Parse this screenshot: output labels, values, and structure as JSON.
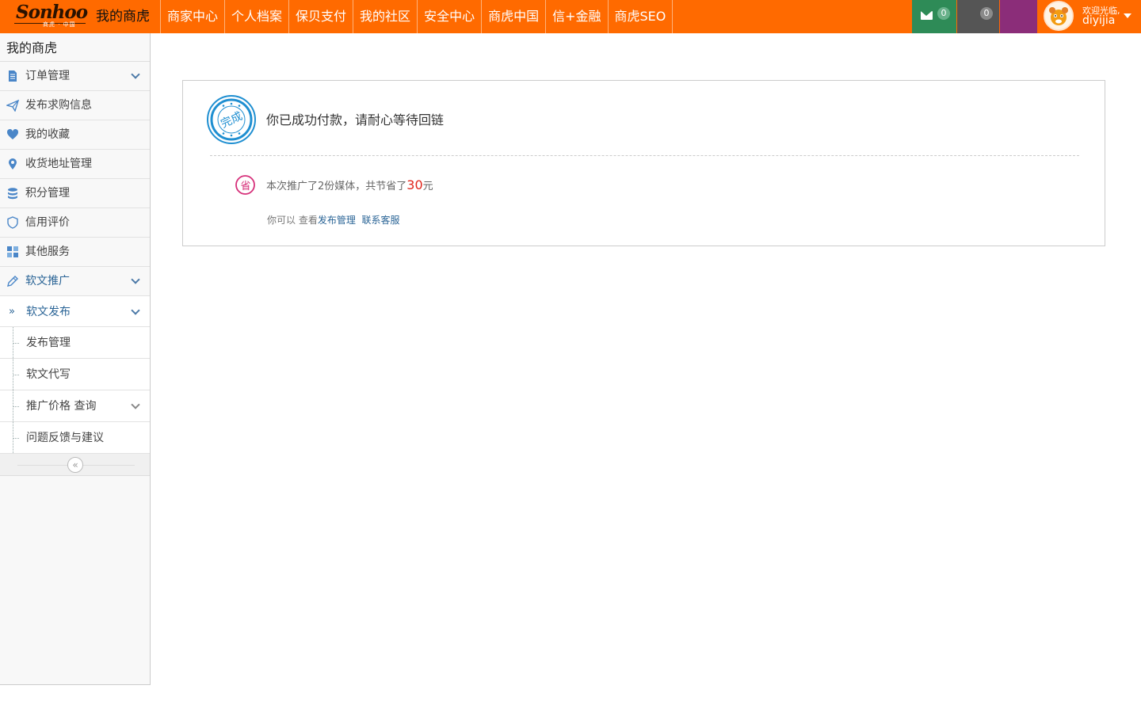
{
  "header": {
    "logo_text": "Sonhoo",
    "logo_sub": "商虎 · 中国",
    "brand": "我的商虎",
    "nav": [
      "商家中心",
      "个人档案",
      "保贝支付",
      "我的社区",
      "安全中心",
      "商虎中国",
      "信+金融",
      "商虎SEO"
    ],
    "mail_count": "0",
    "notice_count": "0",
    "welcome": "欢迎光临,",
    "username": "diyijia"
  },
  "sidebar": {
    "title": "我的商虎",
    "items": [
      {
        "label": "订单管理",
        "icon": "document-icon"
      },
      {
        "label": "发布求购信息",
        "icon": "paper-plane-icon"
      },
      {
        "label": "我的收藏",
        "icon": "heart-icon"
      },
      {
        "label": "收货地址管理",
        "icon": "map-pin-icon"
      },
      {
        "label": "积分管理",
        "icon": "database-icon"
      },
      {
        "label": "信用评价",
        "icon": "shield-icon"
      },
      {
        "label": "其他服务",
        "icon": "grid-icon"
      },
      {
        "label": "软文推广",
        "icon": "pen-icon"
      }
    ],
    "sub_items": [
      "软文发布",
      "发布管理",
      "软文代写",
      "推广价格 查询",
      "问题反馈与建议"
    ],
    "collapse_glyph": "«"
  },
  "content": {
    "stamp_text": "完成",
    "success_message": "你已成功付款，请耐心等待回链",
    "save_badge": "省",
    "save_prefix": "本次推广了2份媒体，共节省了",
    "save_amount": "30",
    "save_unit": "元",
    "links_prefix": "你可以 查看",
    "link_publish_manage": "发布管理",
    "link_contact": "联系客服"
  },
  "colors": {
    "accent": "#ff6a00",
    "mail_bg": "#2e8b57",
    "note_bg": "#555555",
    "purple_bg": "#8b2d79",
    "link": "#2a6496",
    "highlight_red": "#e0241a"
  }
}
